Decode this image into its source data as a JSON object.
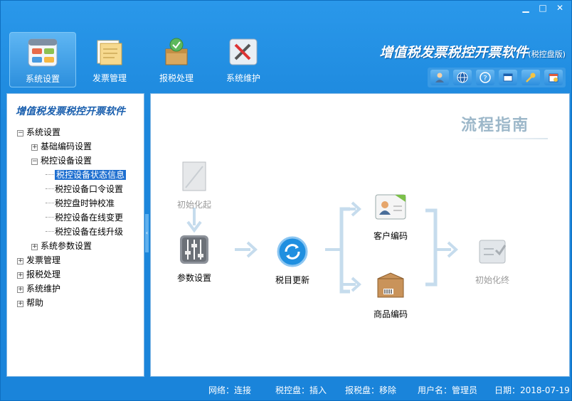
{
  "window": {
    "minimize": "▁",
    "maximize": "□",
    "close": "✕"
  },
  "toolbar": [
    {
      "label": "系统设置",
      "icon": "settings-panel-icon",
      "active": true
    },
    {
      "label": "发票管理",
      "icon": "folder-icon"
    },
    {
      "label": "报税处理",
      "icon": "tax-box-icon"
    },
    {
      "label": "系统维护",
      "icon": "tools-icon"
    }
  ],
  "brand": {
    "title": "增值税发票税控开票软件",
    "edition": "(税控盘版)"
  },
  "quick_icons": [
    "user-icon",
    "globe-icon",
    "help-icon",
    "window-icon",
    "key-icon",
    "calendar-icon"
  ],
  "left": {
    "title": "增值税发票税控开票软件",
    "tree": [
      {
        "label": "系统设置",
        "level": 0,
        "exp": "−"
      },
      {
        "label": "基础编码设置",
        "level": 1,
        "exp": "+"
      },
      {
        "label": "税控设备设置",
        "level": 1,
        "exp": "−"
      },
      {
        "label": "税控设备状态信息",
        "level": 2,
        "selected": true
      },
      {
        "label": "税控设备口令设置",
        "level": 2
      },
      {
        "label": "税控盘时钟校准",
        "level": 2
      },
      {
        "label": "税控设备在线变更",
        "level": 2
      },
      {
        "label": "税控设备在线升级",
        "level": 2
      },
      {
        "label": "系统参数设置",
        "level": 1,
        "exp": "+"
      },
      {
        "label": "发票管理",
        "level": 0,
        "exp": "+"
      },
      {
        "label": "报税处理",
        "level": 0,
        "exp": "+"
      },
      {
        "label": "系统维护",
        "level": 0,
        "exp": "+"
      },
      {
        "label": "帮助",
        "level": 0,
        "exp": "+"
      }
    ]
  },
  "flow": {
    "title": "流程指南",
    "steps": {
      "init_start": "初始化起",
      "params": "参数设置",
      "tax_update": "税目更新",
      "customer": "客户编码",
      "product": "商品编码",
      "init_end": "初始化终"
    }
  },
  "status": {
    "network": "网络：连接",
    "tax_disk": "税控盘：插入",
    "report_disk": "报税盘：移除",
    "user": "用户名：管理员",
    "date": "日期：2018-07-19"
  },
  "colors": {
    "accent": "#1c87dc",
    "selected": "#1e6fd0",
    "flow_arrow": "#c6dced"
  }
}
